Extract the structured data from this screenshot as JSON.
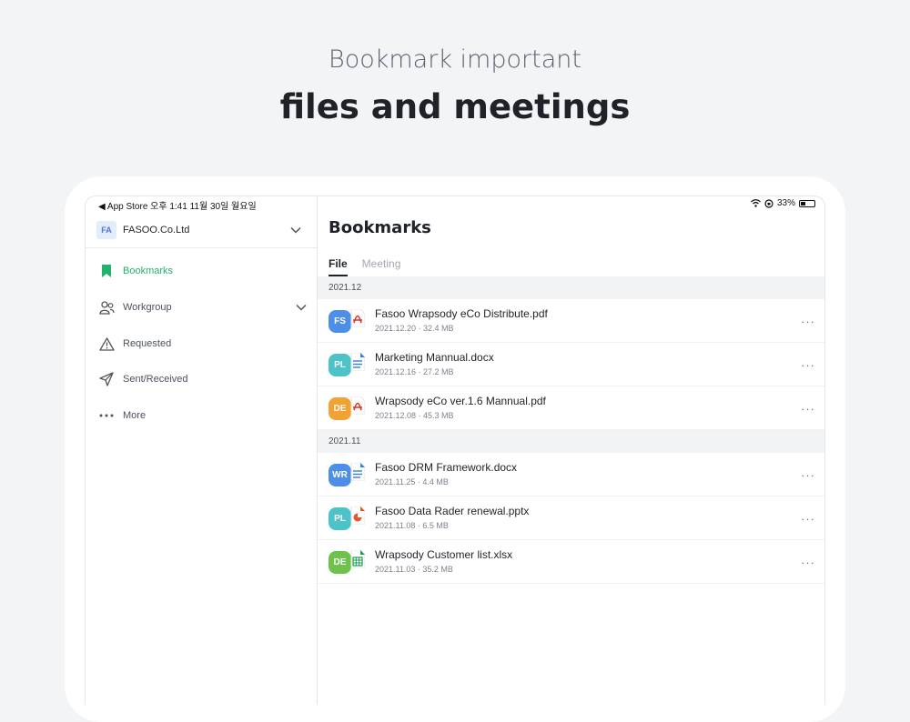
{
  "headline": {
    "line1": "Bookmark important",
    "line2": "files and meetings"
  },
  "status_bar": {
    "left": "◀ App Store  오후 1:41  11월 30일 월요일",
    "battery": "33%"
  },
  "sidebar": {
    "org_badge": "FA",
    "org_name": "FASOO.Co.Ltd",
    "items": [
      {
        "label": "Bookmarks",
        "icon": "bookmark-icon",
        "active": true
      },
      {
        "label": "Workgroup",
        "icon": "people-icon"
      },
      {
        "label": "Requested",
        "icon": "warning-icon"
      },
      {
        "label": "Sent/Received",
        "icon": "send-icon"
      },
      {
        "label": "More",
        "icon": "more-icon"
      }
    ]
  },
  "main": {
    "title": "Bookmarks",
    "tabs": [
      "File",
      "Meeting"
    ],
    "sections": [
      {
        "header": "2021.12",
        "files": [
          {
            "avatar": "FS",
            "avatar_color": "#4d8fe8",
            "type": "pdf",
            "name": "Fasoo Wrapsody eCo Distribute.pdf",
            "meta": "2021.12.20 · 32.4 MB"
          },
          {
            "avatar": "PL",
            "avatar_color": "#4cc2c9",
            "type": "docx",
            "name": "Marketing Mannual.docx",
            "meta": "2021.12.16 · 27.2 MB"
          },
          {
            "avatar": "DE",
            "avatar_color": "#f2a233",
            "type": "pdf",
            "name": "Wrapsody eCo ver.1.6 Mannual.pdf",
            "meta": "2021.12.08 · 45.3 MB"
          }
        ]
      },
      {
        "header": "2021.11",
        "files": [
          {
            "avatar": "WR",
            "avatar_color": "#4d8fe8",
            "type": "docx",
            "name": "Fasoo DRM Framework.docx",
            "meta": "2021.11.25 · 4.4 MB"
          },
          {
            "avatar": "PL",
            "avatar_color": "#4cc2c9",
            "type": "pptx",
            "name": "Fasoo Data Rader renewal.pptx",
            "meta": "2021.11.08 · 6.5 MB"
          },
          {
            "avatar": "DE",
            "avatar_color": "#6cc24a",
            "type": "xlsx",
            "name": "Wrapsody Customer list.xlsx",
            "meta": "2021.11.03 · 35.2 MB"
          }
        ]
      }
    ],
    "more_glyph": "···"
  },
  "colors": {
    "accent": "#21b36b",
    "pdf": "#e0322c",
    "docx": "#3b7ddd",
    "pptx": "#e8552a",
    "xlsx": "#1f9d55"
  }
}
